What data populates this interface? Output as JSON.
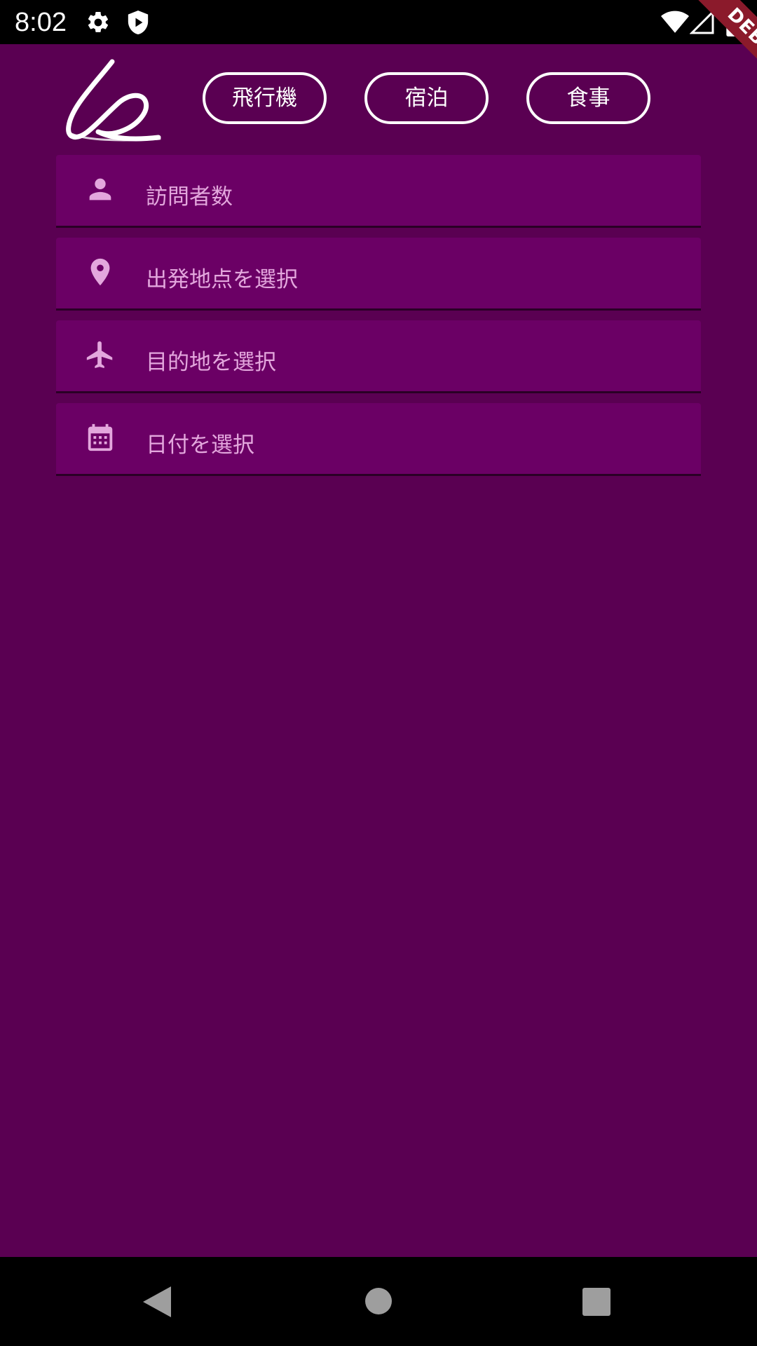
{
  "status_bar": {
    "time": "8:02",
    "icons": [
      "gear-icon",
      "shield-play-icon",
      "wifi-icon",
      "signal-icon",
      "battery-icon"
    ]
  },
  "debug_banner": {
    "label": "DEBUG"
  },
  "header": {
    "logo": "signature-logo",
    "buttons": {
      "flight": "飛行機",
      "stay": "宿泊",
      "meal": "食事"
    }
  },
  "form": {
    "visitors": {
      "icon": "person-icon",
      "placeholder": "訪問者数"
    },
    "departure": {
      "icon": "location-pin-icon",
      "placeholder": "出発地点を選択"
    },
    "destination": {
      "icon": "airplane-icon",
      "placeholder": "目的地を選択"
    },
    "date": {
      "icon": "calendar-icon",
      "placeholder": "日付を選択"
    }
  },
  "nav_bar": {
    "buttons": [
      "back-icon",
      "home-icon",
      "recents-icon"
    ]
  },
  "colors": {
    "background": "#5a0052",
    "field_background": "#6b0065",
    "field_text": "#e3a7dd",
    "status_bar": "#000000",
    "debug_ribbon": "#8b1a2b",
    "pill_border": "#ffffff"
  }
}
